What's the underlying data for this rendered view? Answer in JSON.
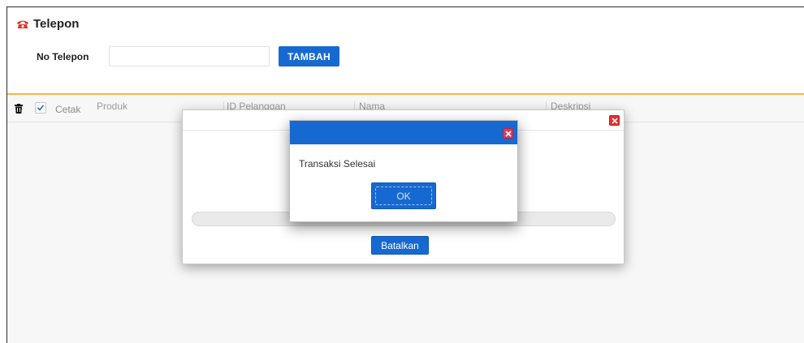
{
  "header": {
    "title": "Telepon",
    "icon": "telephone-icon"
  },
  "form": {
    "phone_label": "No Telepon",
    "phone_value": "",
    "phone_placeholder": "",
    "add_label": "TAMBAH"
  },
  "grid": {
    "print_label": "Cetak",
    "print_checked": true,
    "columns": [
      "Produk",
      "ID Pelanggan",
      "Nama",
      "Deskripsi"
    ]
  },
  "progress_dialog": {
    "progress_text": "0%",
    "cancel_label": "Batalkan"
  },
  "alert_dialog": {
    "message": "Transaksi Selesai",
    "ok_label": "OK"
  },
  "colors": {
    "accent": "#1769d2",
    "divider": "#f5b54a",
    "close": "#e52d2d"
  }
}
